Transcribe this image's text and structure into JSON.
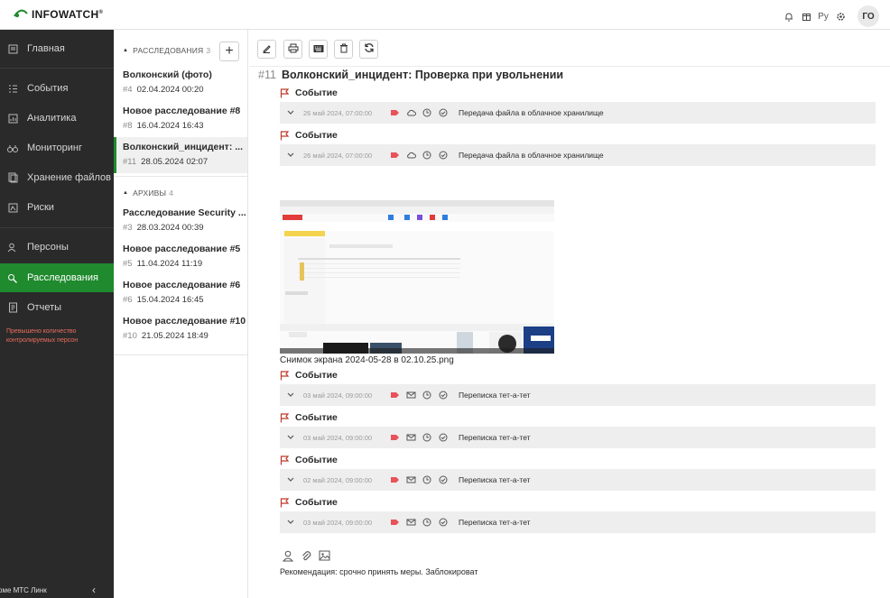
{
  "header": {
    "logo_text": "INFOWATCH",
    "logo_mark": "®",
    "lang": "Ру",
    "avatar_initials": "ГО",
    "icons": [
      "bell-icon",
      "cube-icon",
      "lang-toggle",
      "gear-icon"
    ]
  },
  "sidebar": {
    "items": [
      {
        "label": "Главная",
        "icon": "home-icon"
      },
      {
        "label": "События",
        "icon": "events-icon"
      },
      {
        "label": "Аналитика",
        "icon": "chart-icon"
      },
      {
        "label": "Мониторинг",
        "icon": "binoculars-icon"
      },
      {
        "label": "Хранение файлов",
        "icon": "file-storage-icon"
      },
      {
        "label": "Риски",
        "icon": "risk-icon"
      },
      {
        "label": "Персоны",
        "icon": "persons-icon"
      },
      {
        "label": "Расследования",
        "icon": "investigation-icon"
      },
      {
        "label": "Отчеты",
        "icon": "report-icon"
      }
    ],
    "active_index": 7,
    "warning": "Превышено количество контролируемых персон",
    "bottom_text": "рме МТС Линк",
    "collapse_icon": "chevron-left-icon"
  },
  "list": {
    "investigations_header": "РАССЛЕДОВАНИЯ",
    "investigations_count": "3",
    "archives_header": "АРХИВЫ",
    "archives_count": "4",
    "investigations": [
      {
        "title": "Волконский (фото)",
        "num": "#4",
        "date": "02.04.2024 00:20"
      },
      {
        "title": "Новое расследование #8",
        "num": "#8",
        "date": "16.04.2024 16:43"
      },
      {
        "title": "Волконский_инцидент: ...",
        "num": "#11",
        "date": "28.05.2024 02:07"
      }
    ],
    "archives": [
      {
        "title": "Расследование Security ...",
        "num": "#3",
        "date": "28.03.2024 00:39"
      },
      {
        "title": "Новое расследование #5",
        "num": "#5",
        "date": "11.04.2024 11:19"
      },
      {
        "title": "Новое расследование #6",
        "num": "#6",
        "date": "15.04.2024 16:45"
      },
      {
        "title": "Новое расследование #10",
        "num": "#10",
        "date": "21.05.2024 18:49"
      }
    ],
    "selected_index": 2
  },
  "main": {
    "toolbar": [
      "edit-icon",
      "print-icon",
      "keyboard-icon",
      "trash-icon",
      "refresh-icon"
    ],
    "title_num": "#11",
    "title": "Волконский_инцидент: Проверка при увольнении",
    "event_label": "Событие",
    "events_top": [
      {
        "date": "26 май 2024, 07:00:00",
        "channel": "cloud-icon",
        "desc": "Передача файла в облачное хранилище"
      },
      {
        "date": "26 май 2024, 07:00:00",
        "channel": "cloud-icon",
        "desc": "Передача файла в облачное хранилище"
      }
    ],
    "attachment_caption": "Снимок экрана 2024-05-28 в 02.10.25.png",
    "events_bottom": [
      {
        "date": "03 май 2024, 09:00:00",
        "channel": "mail-icon",
        "desc": "Переписка тет-а-тет"
      },
      {
        "date": "03 май 2024, 09:00:00",
        "channel": "mail-icon",
        "desc": "Переписка тет-а-тет"
      },
      {
        "date": "02 май 2024, 09:00:00",
        "channel": "mail-icon",
        "desc": "Переписка тет-а-тет"
      },
      {
        "date": "03 май 2024, 09:00:00",
        "channel": "mail-icon",
        "desc": "Переписка тет-а-тет"
      }
    ],
    "comment": "Рекомендация: срочно принять меры. Заблокироват"
  },
  "colors": {
    "accent_green": "#1f8a2e",
    "sidebar_bg": "#2a2a2a",
    "warning_red": "#e96d5e",
    "tag_red": "#e8525a"
  }
}
